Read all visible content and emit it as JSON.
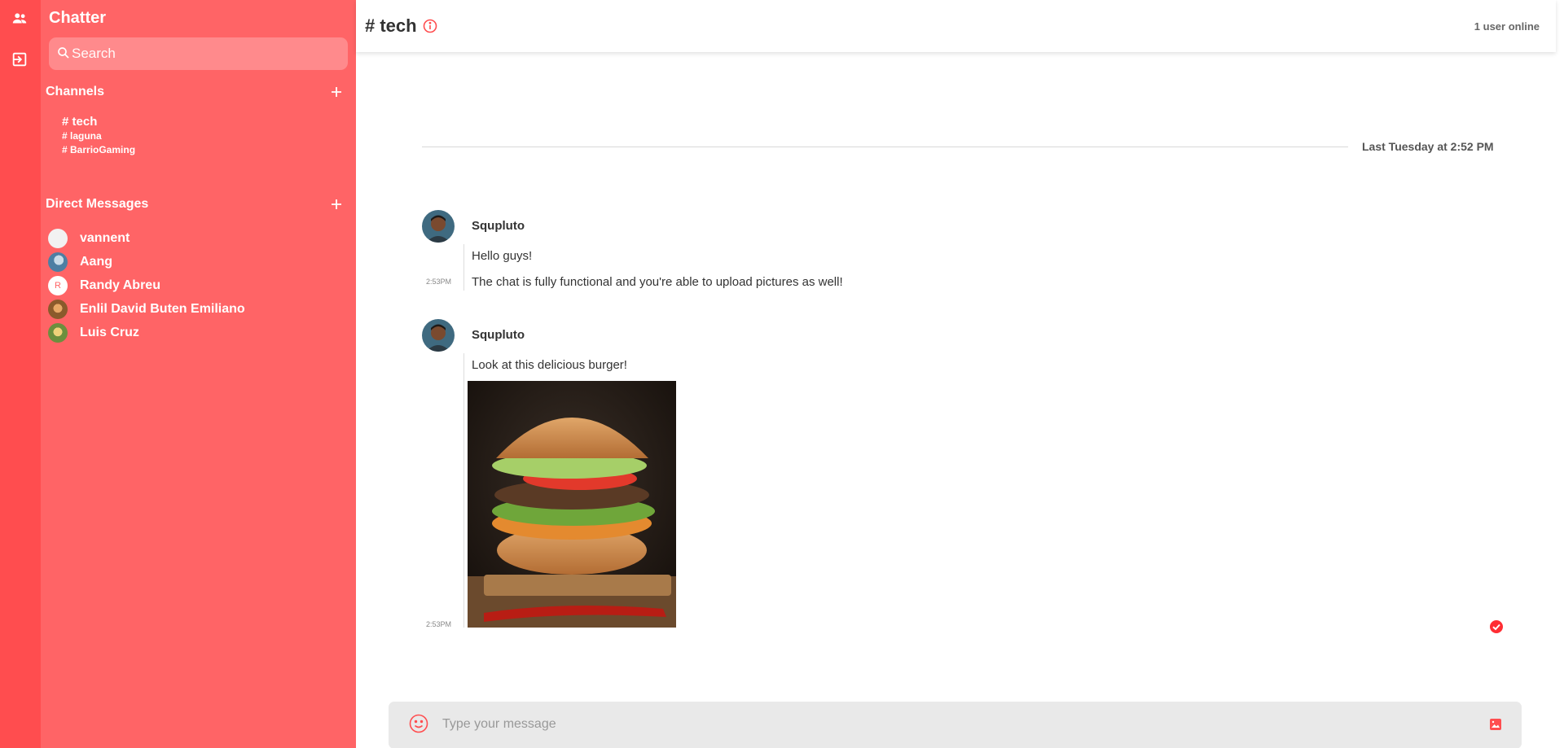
{
  "app": {
    "name": "Chatter"
  },
  "colors": {
    "accent": "#ff4d4f",
    "sidebar": "#ff6466",
    "rail": "#ff4d4f"
  },
  "rail": {
    "icons": [
      "people-icon",
      "logout-icon"
    ]
  },
  "search": {
    "placeholder": "Search"
  },
  "channels": {
    "title": "Channels",
    "items": [
      {
        "label": "# tech",
        "active": true
      },
      {
        "label": "# laguna",
        "active": false
      },
      {
        "label": "# BarrioGaming",
        "active": false
      }
    ]
  },
  "direct_messages": {
    "title": "Direct Messages",
    "users": [
      {
        "name": "vannent",
        "avatar": "blank-avatar"
      },
      {
        "name": "Aang",
        "avatar": "photo-avatar"
      },
      {
        "name": "Randy Abreu",
        "avatar": "letter-avatar",
        "initial": "R"
      },
      {
        "name": "Enlil David Buten Emiliano",
        "avatar": "photo-avatar"
      },
      {
        "name": "Luis Cruz",
        "avatar": "photo-avatar"
      }
    ]
  },
  "header": {
    "channel": "# tech",
    "online": "1 user online"
  },
  "chat": {
    "divider": "Last Tuesday at 2:52 PM",
    "groups": [
      {
        "author": "Squpluto",
        "messages": [
          {
            "text": "Hello guys!"
          },
          {
            "text": "The chat is fully functional and you're able to upload pictures as well!",
            "time": "2:53PM"
          }
        ]
      },
      {
        "author": "Squpluto",
        "messages": [
          {
            "text": "Look at this delicious burger!"
          },
          {
            "image": "burger-photo",
            "time": "2:53PM"
          }
        ]
      }
    ]
  },
  "composer": {
    "placeholder": "Type your message"
  }
}
